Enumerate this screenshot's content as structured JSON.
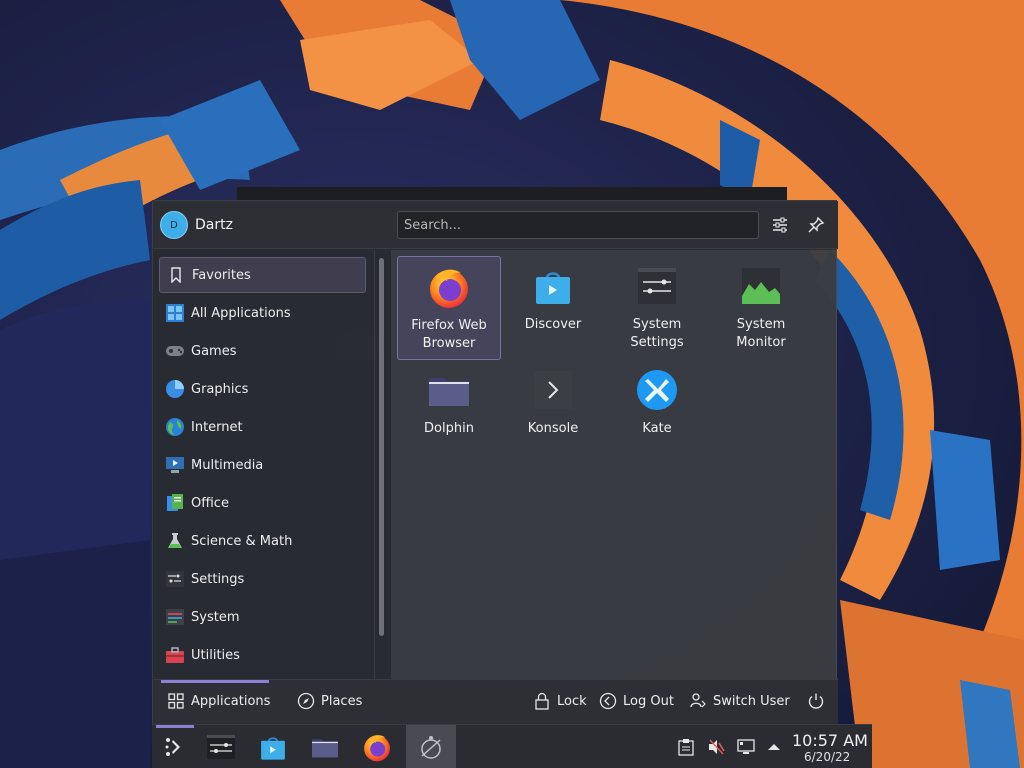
{
  "user": {
    "name": "Dartz",
    "initial": "D"
  },
  "search": {
    "placeholder": "Search..."
  },
  "header": {
    "configure_icon": "sliders-icon",
    "pin_icon": "pin-icon"
  },
  "categories": [
    {
      "label": "Favorites",
      "icon": "bookmark-icon",
      "selected": true
    },
    {
      "label": "All Applications",
      "icon": "grid-icon"
    },
    {
      "label": "Games",
      "icon": "gamepad-icon"
    },
    {
      "label": "Graphics",
      "icon": "graphics-icon"
    },
    {
      "label": "Internet",
      "icon": "globe-icon"
    },
    {
      "label": "Multimedia",
      "icon": "multimedia-icon"
    },
    {
      "label": "Office",
      "icon": "office-icon"
    },
    {
      "label": "Science & Math",
      "icon": "flask-icon"
    },
    {
      "label": "Settings",
      "icon": "settings-icon"
    },
    {
      "label": "System",
      "icon": "system-icon"
    },
    {
      "label": "Utilities",
      "icon": "toolbox-icon"
    }
  ],
  "favorites": [
    {
      "label_line1": "Firefox Web",
      "label_line2": "Browser",
      "icon": "firefox-icon",
      "selected": true
    },
    {
      "label_line1": "Discover",
      "label_line2": "",
      "icon": "discover-icon"
    },
    {
      "label_line1": "System",
      "label_line2": "Settings",
      "icon": "system-settings-icon"
    },
    {
      "label_line1": "System",
      "label_line2": "Monitor",
      "icon": "system-monitor-icon"
    },
    {
      "label_line1": "Dolphin",
      "label_line2": "",
      "icon": "folder-icon"
    },
    {
      "label_line1": "Konsole",
      "label_line2": "",
      "icon": "terminal-icon"
    },
    {
      "label_line1": "Kate",
      "label_line2": "",
      "icon": "kate-icon"
    }
  ],
  "footer": {
    "applications": "Applications",
    "places": "Places",
    "lock": "Lock",
    "logout": "Log Out",
    "switch_user": "Switch User"
  },
  "taskbar": {
    "items": [
      "application-launcher-icon",
      "system-settings-icon",
      "discover-icon",
      "folder-icon",
      "firefox-icon",
      "krunner-icon"
    ],
    "tray": [
      "clipboard-icon",
      "volume-muted-icon",
      "network-icon",
      "expand-tray-icon"
    ],
    "time": "10:57 AM",
    "date": "6/20/22"
  },
  "colors": {
    "accent": "#8d7fd6",
    "panel": "#2a2c31"
  }
}
